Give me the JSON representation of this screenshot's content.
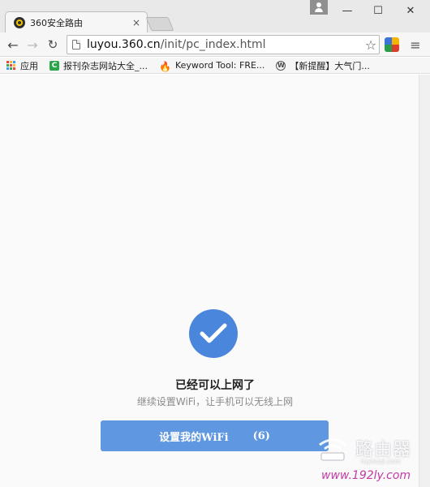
{
  "browser": {
    "tab": {
      "title": "360安全路由",
      "close": "×"
    },
    "window_controls": {
      "minimize": "—",
      "maximize": "☐",
      "close": "✕"
    },
    "toolbar": {
      "back": "←",
      "forward": "→",
      "reload": "↻",
      "url_host": "luyou.360.cn",
      "url_path": "/init/pc_index.html",
      "star": "☆",
      "menu": "≡"
    },
    "bookmarks": [
      {
        "label": "应用",
        "icon": "apps-grid-icon"
      },
      {
        "label": "报刊杂志网站大全_...",
        "icon": "green-c-icon"
      },
      {
        "label": "Keyword Tool: FRE...",
        "icon": "fire-icon"
      },
      {
        "label": "【新提醒】大气门...",
        "icon": "wordpress-icon"
      }
    ],
    "apps_colors": [
      "#e8453c",
      "#f9bb2d",
      "#3b9df0",
      "#37a853",
      "#e8453c",
      "#f9bb2d",
      "#3b9df0",
      "#37a853",
      "#e8453c"
    ]
  },
  "main": {
    "status_icon": "check-circle-icon",
    "title": "已经可以上网了",
    "subtitle": "继续设置WiFi，让手机可以无线上网",
    "button_label": "设置我的WiFi",
    "button_countdown": "(6)",
    "accent_color": "#4a86dc",
    "button_color": "#5f97e0"
  },
  "watermark": {
    "text": "路由器",
    "small": "luyouqi.com",
    "url": "www.192ly.com"
  }
}
